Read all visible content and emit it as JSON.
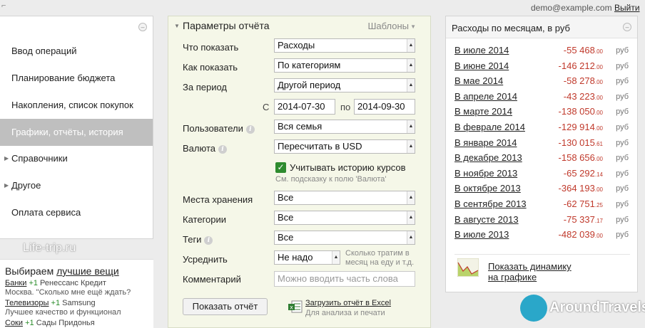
{
  "topbar": {
    "user_email": "demo@example.com",
    "logout": "Выйти"
  },
  "sidebar": {
    "items": [
      {
        "label": "Ввод операций"
      },
      {
        "label": "Планирование бюджета"
      },
      {
        "label": "Накопления, список покупок"
      },
      {
        "label": "Графики, отчёты, история"
      },
      {
        "label": "Справочники"
      },
      {
        "label": "Другое"
      },
      {
        "label": "Оплата сервиса"
      }
    ],
    "active_index": 3
  },
  "brand": "Life-trip.ru",
  "promo": {
    "title_prefix": "Выбираем ",
    "title_link": "лучшие вещи",
    "rows": [
      {
        "link": "Банки",
        "plus": "+1",
        "rest": "Ренессанс Кредит",
        "sub": "Москва. \"Сколько мне ещё ждать?"
      },
      {
        "link": "Телевизоры",
        "plus": "+1",
        "rest": "Samsung",
        "sub": "Лучшее качество и функционал"
      },
      {
        "link": "Соки",
        "plus": "+1",
        "rest": "Сады Придонья",
        "sub": ""
      }
    ]
  },
  "params": {
    "title": "Параметры отчёта",
    "templates": "Шаблоны",
    "what_label": "Что показать",
    "what_value": "Расходы",
    "how_label": "Как показать",
    "how_value": "По категориям",
    "period_label": "За период",
    "period_value": "Другой период",
    "from_label": "С",
    "from_value": "2014-07-30",
    "to_label": "по",
    "to_value": "2014-09-30",
    "users_label": "Пользователи",
    "users_value": "Вся семья",
    "currency_label": "Валюта",
    "currency_value": "Пересчитать в USD",
    "rate_checkbox_label": "Учитывать историю курсов",
    "rate_checkbox_checked": true,
    "rate_hint": "См. подсказку к полю 'Валюта'",
    "storage_label": "Места хранения",
    "storage_value": "Все",
    "categories_label": "Категории",
    "categories_value": "Все",
    "tags_label": "Теги",
    "tags_value": "Все",
    "average_label": "Усреднить",
    "average_value": "Не надо",
    "average_hint": "Сколько тратим в месяц на еду и т.д.",
    "comment_label": "Комментарий",
    "comment_placeholder": "Можно вводить часть слова",
    "show_button": "Показать отчёт",
    "excel_link": "Загрузить отчёт в Excel",
    "excel_sub": "Для анализа и печати"
  },
  "monthly": {
    "title": "Расходы по месяцам, в руб",
    "currency": "руб",
    "accent_color": "#c0392b",
    "rows": [
      {
        "month": "В июле 2014",
        "amount": "-55 468",
        "cents": ".00"
      },
      {
        "month": "В июне 2014",
        "amount": "-146 212",
        "cents": ".00"
      },
      {
        "month": "В мае 2014",
        "amount": "-58 278",
        "cents": ".00"
      },
      {
        "month": "В апреле 2014",
        "amount": "-43 223",
        "cents": ".00"
      },
      {
        "month": "В марте 2014",
        "amount": "-138 050",
        "cents": ".00"
      },
      {
        "month": "В феврале 2014",
        "amount": "-129 914",
        "cents": ".00"
      },
      {
        "month": "В январе 2014",
        "amount": "-130 015",
        "cents": ".61"
      },
      {
        "month": "В декабре 2013",
        "amount": "-158 656",
        "cents": ".00"
      },
      {
        "month": "В ноябре 2013",
        "amount": "-65 292",
        "cents": ".14"
      },
      {
        "month": "В октябре 2013",
        "amount": "-364 193",
        "cents": ".00"
      },
      {
        "month": "В сентябре 2013",
        "amount": "-62 751",
        "cents": ".25"
      },
      {
        "month": "В августе 2013",
        "amount": "-75 337",
        "cents": ".17"
      },
      {
        "month": "В июле 2013",
        "amount": "-482 039",
        "cents": ".00"
      }
    ],
    "dynamics_link_1": "Показать динамику",
    "dynamics_link_2": "на графике"
  },
  "watermark": "AroundTravels"
}
